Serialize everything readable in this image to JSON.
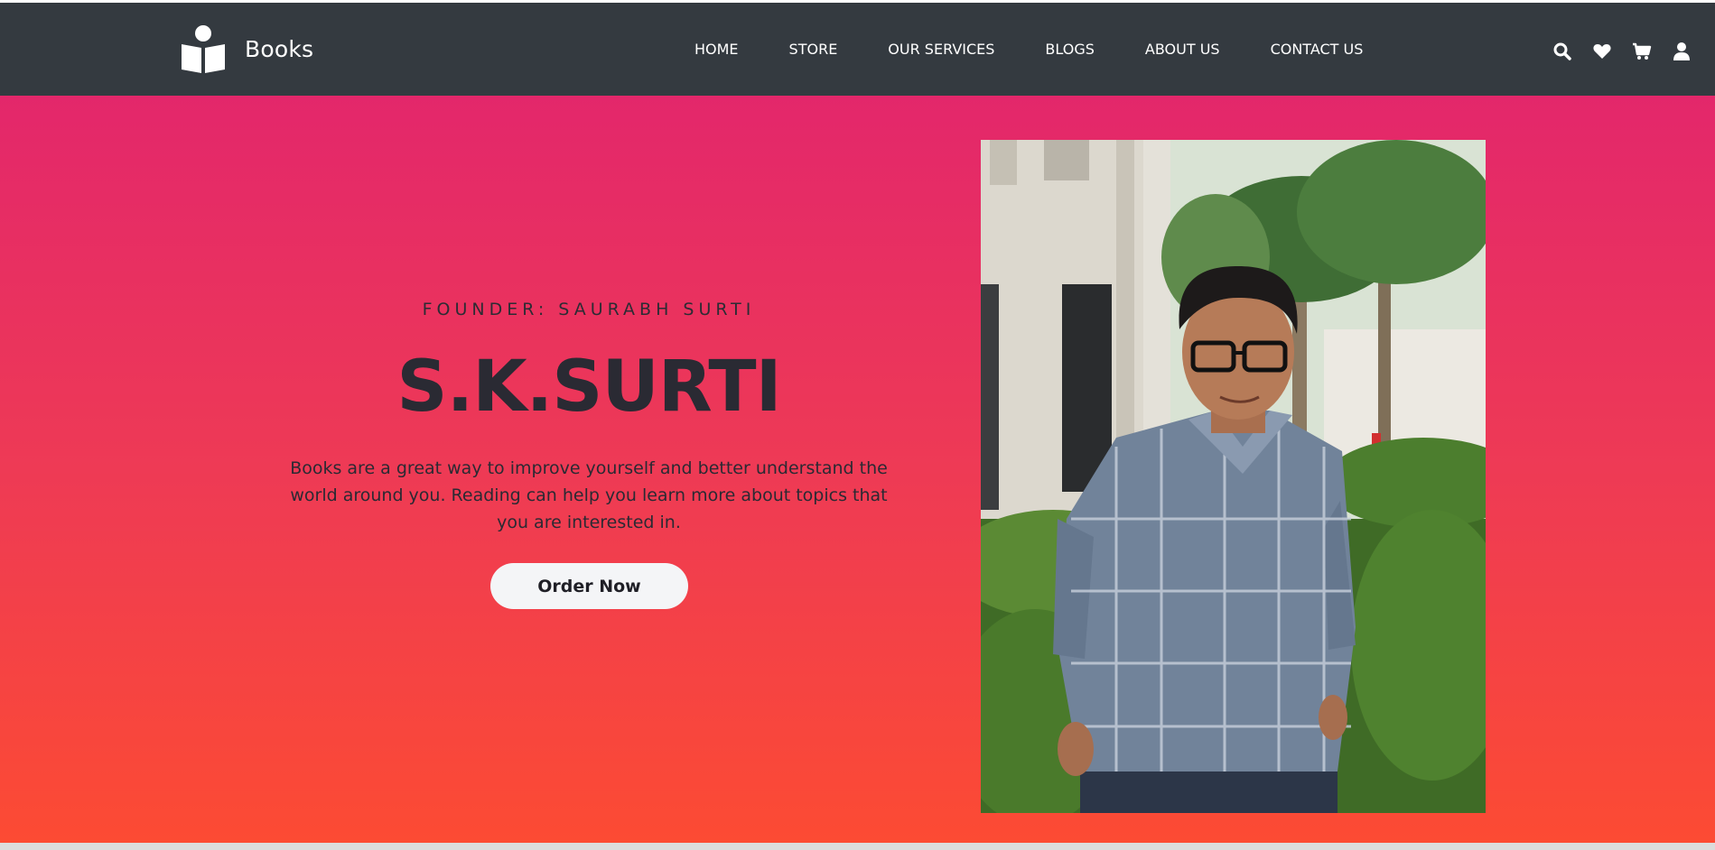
{
  "brand": {
    "name": "Books",
    "logo": "book-reader-icon"
  },
  "nav": {
    "items": [
      {
        "label": "HOME"
      },
      {
        "label": "STORE"
      },
      {
        "label": "OUR SERVICES"
      },
      {
        "label": "BLOGS"
      },
      {
        "label": "ABOUT US"
      },
      {
        "label": "CONTACT US"
      }
    ]
  },
  "header_icons": [
    "search-icon",
    "heart-icon",
    "cart-icon",
    "user-icon"
  ],
  "hero": {
    "founder_line": "FOUNDER: SAURABH SURTI",
    "title": "S.K.SURTI",
    "description": "Books are a great way to improve yourself and better understand the world around you. Reading can help you learn more about topics that you are interested in.",
    "cta_label": "Order Now"
  },
  "colors": {
    "header_bg": "#343a40",
    "hero_gradient_top": "#e3276b",
    "hero_gradient_bottom": "#fc4b33",
    "button_bg": "#f4f5f7",
    "text_dark": "#2a2a33"
  }
}
